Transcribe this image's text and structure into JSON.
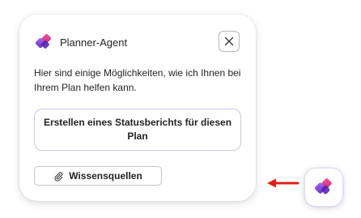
{
  "panel": {
    "title": "Planner-Agent",
    "logo_icon": "planner-agent-logo-icon",
    "close_icon": "close-icon",
    "intro_text": "Hier sind einige Möglichkeiten, wie ich Ihnen bei Ihrem Plan helfen kann.",
    "suggestion_button_label": "Erstellen eines Statusberichts für diesen Plan",
    "sources_button_label": "Wissensquellen",
    "sources_icon": "paperclip-icon"
  },
  "launcher": {
    "icon": "planner-agent-logo-icon"
  },
  "annotation": {
    "arrow_icon": "arrow-left-icon",
    "arrow_color": "#e0201a"
  },
  "colors": {
    "logo_purple": "#7b3fd6",
    "logo_magenta": "#d9349b",
    "logo_pink": "#f0508a",
    "border_accent": "#cdc6e8"
  }
}
